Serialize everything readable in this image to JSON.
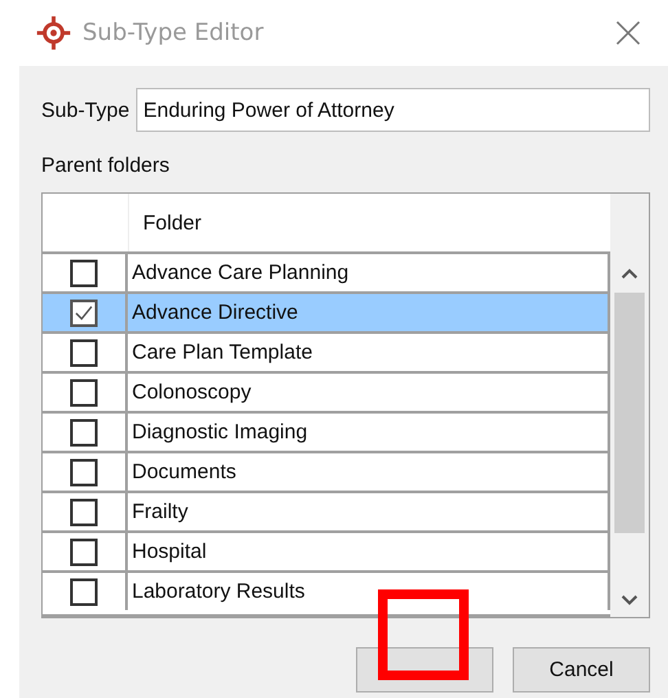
{
  "window": {
    "title": "Sub-Type Editor"
  },
  "sub_type": {
    "label": "Sub-Type",
    "value": "Enduring Power of Attorney"
  },
  "parent_folders": {
    "label": "Parent folders",
    "columns": [
      "Folder"
    ],
    "rows": [
      {
        "folder": "Advance Care Planning",
        "checked": false,
        "selected": false
      },
      {
        "folder": "Advance Directive",
        "checked": true,
        "selected": true
      },
      {
        "folder": "Care Plan Template",
        "checked": false,
        "selected": false
      },
      {
        "folder": "Colonoscopy",
        "checked": false,
        "selected": false
      },
      {
        "folder": "Diagnostic Imaging",
        "checked": false,
        "selected": false
      },
      {
        "folder": "Documents",
        "checked": false,
        "selected": false
      },
      {
        "folder": "Frailty",
        "checked": false,
        "selected": false
      },
      {
        "folder": "Hospital",
        "checked": false,
        "selected": false
      },
      {
        "folder": "Laboratory Results",
        "checked": false,
        "selected": false
      }
    ]
  },
  "buttons": [
    {
      "highlighted": true
    },
    {
      "label": "Cancel",
      "highlighted": false
    }
  ]
}
